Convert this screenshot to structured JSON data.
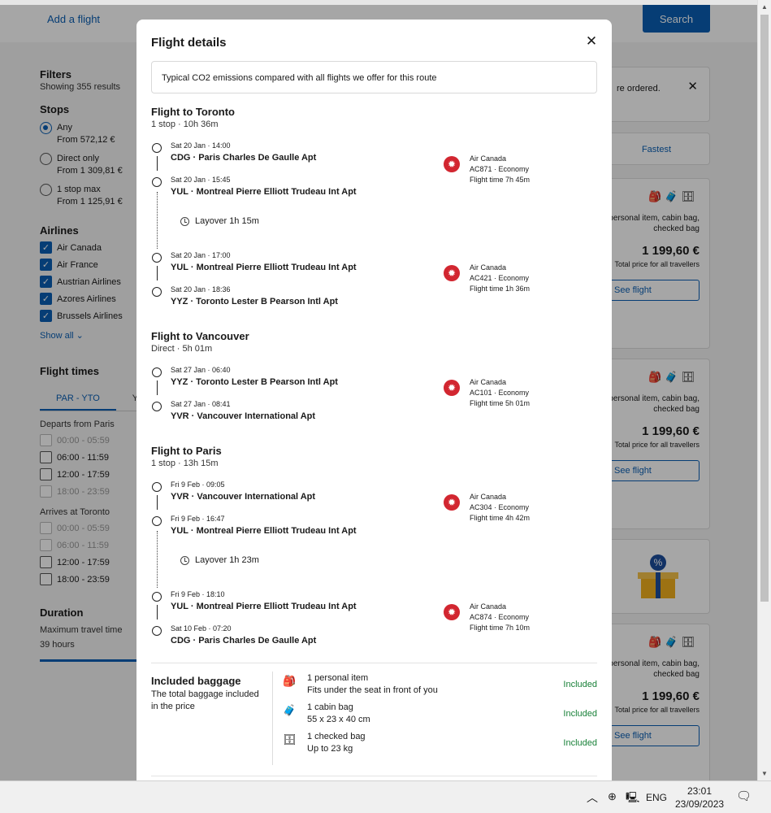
{
  "header": {
    "add_flight": "Add a flight",
    "search": "Search"
  },
  "filters": {
    "title": "Filters",
    "results": "Showing 355 results",
    "stops": {
      "heading": "Stops",
      "options": [
        {
          "label": "Any",
          "price": "From 572,12 €"
        },
        {
          "label": "Direct only",
          "price": "From 1 309,81 €"
        },
        {
          "label": "1 stop max",
          "price": "From 1 125,91 €"
        }
      ]
    },
    "airlines": {
      "heading": "Airlines",
      "items": [
        "Air Canada",
        "Air France",
        "Austrian Airlines",
        "Azores Airlines",
        "Brussels Airlines"
      ],
      "show_all": "Show all"
    },
    "flight_times": {
      "heading": "Flight times",
      "tab_active": "PAR - YTO",
      "tab_other": "Y",
      "departs_heading": "Departs from Paris",
      "departs": [
        "00:00 - 05:59",
        "06:00 - 11:59",
        "12:00 - 17:59",
        "18:00 - 23:59"
      ],
      "arrives_heading": "Arrives at Toronto",
      "arrives": [
        "00:00 - 05:59",
        "06:00 - 11:59",
        "12:00 - 17:59",
        "18:00 - 23:59"
      ]
    },
    "duration": {
      "heading": "Duration",
      "label": "Maximum travel time",
      "value": "39 hours"
    }
  },
  "results": {
    "notice": "re ordered.",
    "fastest": "Fastest",
    "baggage_text_1": ": personal item, cabin bag,",
    "baggage_text_2": "checked bag",
    "price": "1 199,60 €",
    "price_sub": "Total price for all travellers",
    "see_flight": "See flight"
  },
  "modal": {
    "title": "Flight details",
    "co2": "Typical CO2 emissions compared with all flights we offer for this route",
    "legs": [
      {
        "heading": "Flight to Toronto",
        "summary": "1 stop · 10h 36m",
        "segments": [
          {
            "dep_time": "Sat 20 Jan · 14:00",
            "dep_apt": "CDG · Paris Charles De Gaulle Apt",
            "arr_time": "Sat 20 Jan · 15:45",
            "arr_apt": "YUL · Montreal Pierre Elliott Trudeau Int Apt",
            "airline": "Air Canada",
            "code": "AC871 · Economy",
            "flight_time": "Flight time 7h 45m"
          },
          {
            "dep_time": "Sat 20 Jan · 17:00",
            "dep_apt": "YUL · Montreal Pierre Elliott Trudeau Int Apt",
            "arr_time": "Sat 20 Jan · 18:36",
            "arr_apt": "YYZ · Toronto Lester B Pearson Intl Apt",
            "airline": "Air Canada",
            "code": "AC421 · Economy",
            "flight_time": "Flight time 1h 36m"
          }
        ],
        "layover": "Layover 1h 15m"
      },
      {
        "heading": "Flight to Vancouver",
        "summary": "Direct · 5h 01m",
        "segments": [
          {
            "dep_time": "Sat 27 Jan · 06:40",
            "dep_apt": "YYZ · Toronto Lester B Pearson Intl Apt",
            "arr_time": "Sat 27 Jan · 08:41",
            "arr_apt": "YVR · Vancouver International Apt",
            "airline": "Air Canada",
            "code": "AC101 · Economy",
            "flight_time": "Flight time 5h 01m"
          }
        ]
      },
      {
        "heading": "Flight to Paris",
        "summary": "1 stop · 13h 15m",
        "segments": [
          {
            "dep_time": "Fri 9 Feb · 09:05",
            "dep_apt": "YVR · Vancouver International Apt",
            "arr_time": "Fri 9 Feb · 16:47",
            "arr_apt": "YUL · Montreal Pierre Elliott Trudeau Int Apt",
            "airline": "Air Canada",
            "code": "AC304 · Economy",
            "flight_time": "Flight time 4h 42m"
          },
          {
            "dep_time": "Fri 9 Feb · 18:10",
            "dep_apt": "YUL · Montreal Pierre Elliott Trudeau Int Apt",
            "arr_time": "Sat 10 Feb · 07:20",
            "arr_apt": "CDG · Paris Charles De Gaulle Apt",
            "airline": "Air Canada",
            "code": "AC874 · Economy",
            "flight_time": "Flight time 7h 10m"
          }
        ],
        "layover": "Layover 1h 23m"
      }
    ],
    "baggage": {
      "title": "Included baggage",
      "subtitle": "The total baggage included in the price",
      "items": [
        {
          "icon": "personal-item-icon",
          "line1": "1 personal item",
          "line2": "Fits under the seat in front of you",
          "status": "Included"
        },
        {
          "icon": "cabin-bag-icon",
          "line1": "1 cabin bag",
          "line2": "55 x 23 x 40 cm",
          "status": "Included"
        },
        {
          "icon": "checked-bag-icon",
          "line1": "1 checked bag",
          "line2": "Up to 23 kg",
          "status": "Included"
        }
      ]
    }
  },
  "taskbar": {
    "lang": "ENG",
    "time": "23:01",
    "date": "23/09/2023"
  },
  "colors": {
    "accent": "#0a5fb4",
    "airline_red": "#d22630",
    "included_green": "#188038"
  }
}
